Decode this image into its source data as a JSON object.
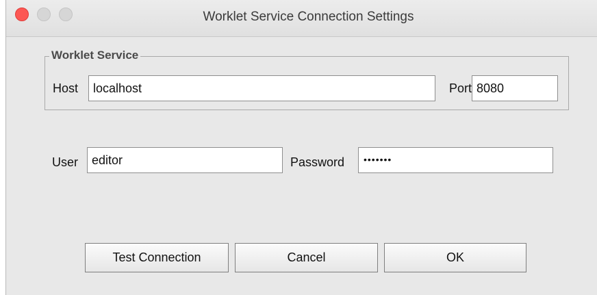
{
  "window": {
    "title": "Worklet Service Connection Settings"
  },
  "worklet_service": {
    "group_label": "Worklet Service",
    "host_label": "Host",
    "host_value": "localhost",
    "port_label": "Port",
    "port_value": "8080"
  },
  "credentials": {
    "user_label": "User",
    "user_value": "editor",
    "password_label": "Password",
    "password_masked": "•••••••"
  },
  "buttons": {
    "test_connection": "Test Connection",
    "cancel": "Cancel",
    "ok": "OK"
  },
  "colors": {
    "close_button": "#fc5753",
    "window_background": "#e8e8e8"
  },
  "icons": {
    "close": "close-icon",
    "minimize": "minimize-icon",
    "zoom": "zoom-icon"
  }
}
